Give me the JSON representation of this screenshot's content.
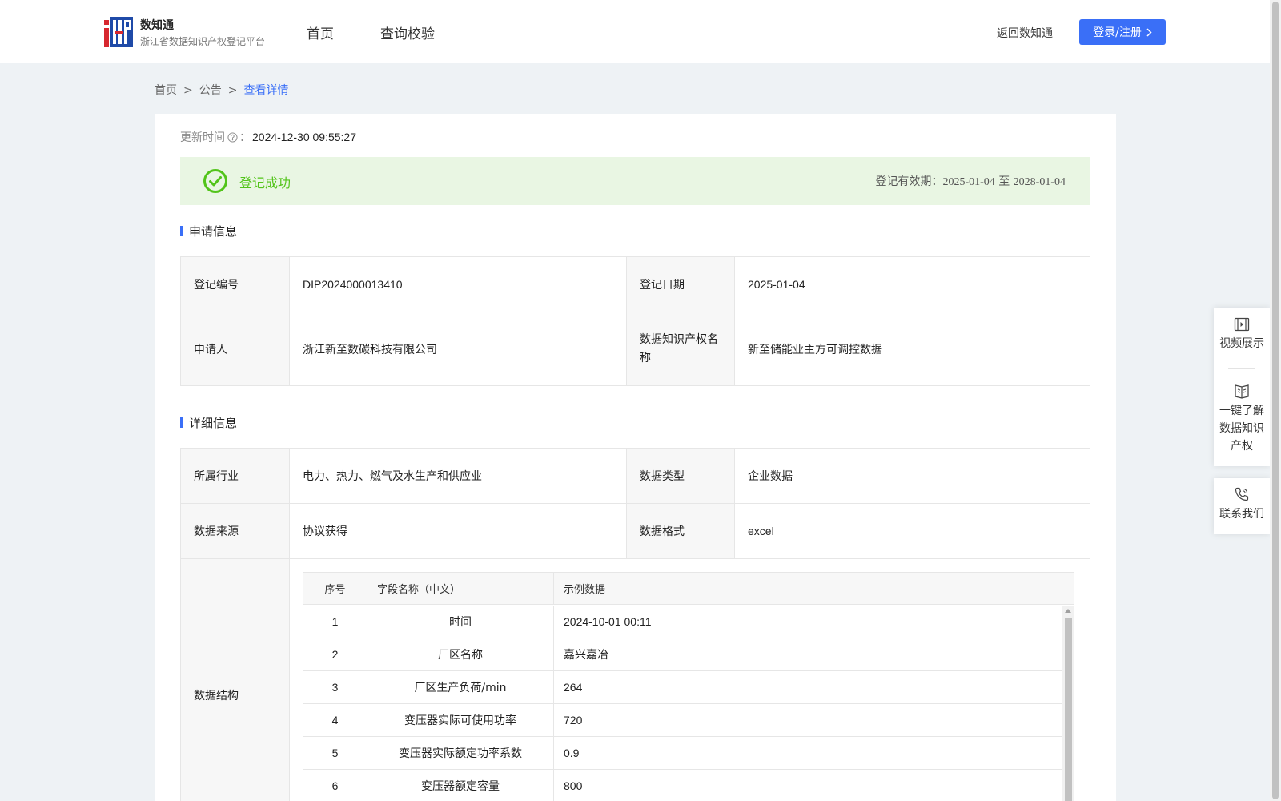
{
  "header": {
    "logo_title": "数知通",
    "logo_subtitle": "浙江省数据知识产权登记平台",
    "nav": [
      {
        "label": "首页"
      },
      {
        "label": "查询校验"
      }
    ],
    "return_link": "返回数知通",
    "login_button": "登录/注册"
  },
  "breadcrumb": {
    "items": [
      "首页",
      "公告",
      "查看详情"
    ],
    "separator": ">"
  },
  "update": {
    "label": "更新时间",
    "colon": "：",
    "value": "2024-12-30 09:55:27"
  },
  "status": {
    "text": "登记成功",
    "validity_label": "登记有效期：",
    "validity_start": "2025-01-04",
    "validity_to": "至",
    "validity_end": "2028-01-04",
    "color": "#52c41a"
  },
  "apply_section": {
    "title": "申请信息",
    "reg_no_label": "登记编号",
    "reg_no": "DIP2024000013410",
    "reg_date_label": "登记日期",
    "reg_date": "2025-01-04",
    "applicant_label": "申请人",
    "applicant": "浙江新至数碳科技有限公司",
    "ip_name_label": "数据知识产权名称",
    "ip_name": "新至储能业主方可调控数据"
  },
  "detail_section": {
    "title": "详细信息",
    "industry_label": "所属行业",
    "industry": "电力、热力、燃气及水生产和供应业",
    "data_type_label": "数据类型",
    "data_type": "企业数据",
    "source_label": "数据来源",
    "source": "协议获得",
    "format_label": "数据格式",
    "format": "excel",
    "structure_label": "数据结构",
    "structure_columns": [
      "序号",
      "字段名称（中文）",
      "示例数据"
    ],
    "structure_rows": [
      {
        "no": "1",
        "field": "时间",
        "sample": "2024-10-01 00:11"
      },
      {
        "no": "2",
        "field": "厂区名称",
        "sample": "嘉兴嘉冶"
      },
      {
        "no": "3",
        "field": "厂区生产负荷/min",
        "sample": "264"
      },
      {
        "no": "4",
        "field": "变压器实际可使用功率",
        "sample": "720"
      },
      {
        "no": "5",
        "field": "变压器实际额定功率系数",
        "sample": "0.9"
      },
      {
        "no": "6",
        "field": "变压器额定容量",
        "sample": "800"
      }
    ]
  },
  "side_panel": {
    "video": "视频展示",
    "learn_line1": "一键了解",
    "learn_line2": "数据知识",
    "learn_line3": "产权",
    "contact": "联系我们"
  },
  "colors": {
    "accent": "#3a6ff7",
    "success": "#52c41a",
    "success_bg": "#e9f6e3",
    "page_bg": "#eef2f5"
  },
  "icons": [
    "logo-icon",
    "help-circle-icon",
    "check-circle-icon",
    "chevron-right-icon",
    "video-icon",
    "book-icon",
    "phone-icon"
  ]
}
